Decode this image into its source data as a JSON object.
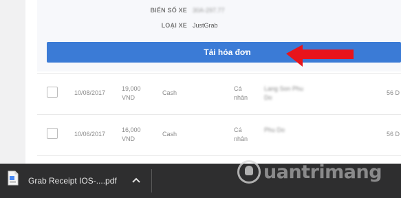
{
  "details": {
    "plate_label": "BIỂN SỐ XE",
    "plate_value": "30A-297.77",
    "vehicle_type_label": "LOẠI XE",
    "vehicle_type_value": "JustGrab"
  },
  "download_button": {
    "label": "Tải hóa đơn"
  },
  "table": {
    "rows": [
      {
        "date": "10/08/2017",
        "amount": "19,000",
        "currency": "VND",
        "payment": "Cash",
        "category_line1": "Cá",
        "category_line2": "nhân",
        "location_line1": "Lang Son Phu",
        "location_line2": "Do",
        "extra": "56 D"
      },
      {
        "date": "10/06/2017",
        "amount": "16,000",
        "currency": "VND",
        "payment": "Cash",
        "category_line1": "Cá",
        "category_line2": "nhân",
        "location_line1": "Phu Do",
        "location_line2": "",
        "extra": "56 D"
      }
    ]
  },
  "download_bar": {
    "file_name": "Grab Receipt IOS-....pdf",
    "file_icon": "pdf-file-icon",
    "menu_icon": "chevron-up-icon"
  },
  "watermark": {
    "text": "uantrimang",
    "icon": "lightbulb-icon"
  },
  "colors": {
    "button_blue": "#3b7bd6",
    "annotation_arrow": "#e8141b",
    "download_bar": "#2e2e2f"
  }
}
